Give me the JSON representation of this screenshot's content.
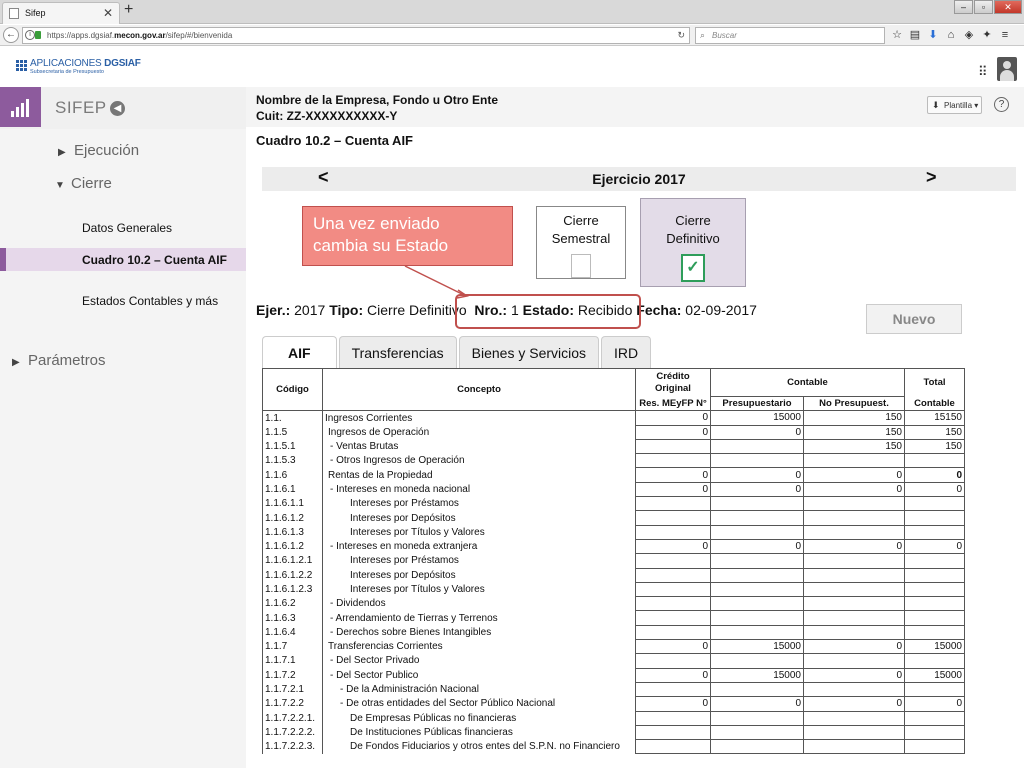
{
  "browser": {
    "tab_title": "Sifep",
    "url_prefix": "https://apps.dgsiaf.",
    "url_domain": "mecon.gov.ar",
    "url_suffix": "/sifep/#/bienvenida",
    "search_placeholder": "Buscar"
  },
  "app": {
    "logo_title": "APLICACIONES",
    "logo_brand": "DGSIAF",
    "logo_subtitle": "Subsecretaria de Presupuesto"
  },
  "sidebar": {
    "title": "SIFEP",
    "items": [
      {
        "label": "Ejecución"
      },
      {
        "label": "Cierre"
      },
      {
        "label": "Datos Generales"
      },
      {
        "label": "Cuadro 10.2  – Cuenta AIF"
      },
      {
        "label": "Estados Contables y más"
      },
      {
        "label": "Parámetros"
      }
    ]
  },
  "header": {
    "company_name": "Nombre de la Empresa, Fondo u Otro Ente",
    "cuit": "Cuit: ZZ-XXXXXXXXXX-Y",
    "plantilla_label": "Plantilla",
    "help": "?"
  },
  "page": {
    "title": "Cuadro 10.2  – Cuenta AIF",
    "prev": "<",
    "next": ">",
    "ejercicio": "Ejercicio 2017"
  },
  "callout": {
    "text_line1": "Una vez enviado",
    "text_line2": "cambia su Estado"
  },
  "cards": {
    "semestral_line1": "Cierre",
    "semestral_line2": "Semestral",
    "definitivo_line1": "Cierre",
    "definitivo_line2": "Definitivo"
  },
  "status": {
    "ejer_label": "Ejer.:",
    "ejer_value": "2017",
    "tipo_label": "Tipo:",
    "tipo_value": "Cierre Definitivo",
    "nro_label": "Nro.:",
    "nro_value": "1",
    "estado_label": "Estado:",
    "estado_value": "Recibido",
    "fecha_label": "Fecha:",
    "fecha_value": "02-09-2017"
  },
  "nuevo_label": "Nuevo",
  "tabs": [
    "AIF",
    "Transferencias",
    "Bienes y Servicios",
    "IRD"
  ],
  "table": {
    "h_codigo": "Código",
    "h_concepto": "Concepto",
    "h_credito_line1": "Crédito",
    "h_credito_line2": "Original",
    "h_credito_sub": "Res. MEyFP N°",
    "h_contable": "Contable",
    "h_presupuestario": "Presupuestario",
    "h_nopresupuest": "No Presupuest.",
    "h_total": "Total",
    "h_total_sub": "Contable",
    "rows": [
      {
        "code": "1.1.",
        "concept": "Ingresos Corrientes",
        "ind": 0,
        "c": "0",
        "p": "15000",
        "np": "150",
        "t": "15150"
      },
      {
        "code": "1.1.5",
        "concept": "Ingresos de Operación",
        "ind": 1,
        "c": "0",
        "p": "0",
        "np": "150",
        "t": "150"
      },
      {
        "code": "1.1.5.1",
        "concept": "- Ventas Brutas",
        "ind": 2,
        "c": "",
        "p": "",
        "np": "150",
        "t": "150"
      },
      {
        "code": "1.1.5.3",
        "concept": "- Otros Ingresos de Operación",
        "ind": 2,
        "c": "",
        "p": "",
        "np": "",
        "t": ""
      },
      {
        "code": "1.1.6",
        "concept": "Rentas de la Propiedad",
        "ind": 1,
        "c": "0",
        "p": "0",
        "np": "0",
        "t": "0"
      },
      {
        "code": "1.1.6.1",
        "concept": "- Intereses en moneda nacional",
        "ind": 2,
        "c": "0",
        "p": "0",
        "np": "0",
        "t": "0"
      },
      {
        "code": "1.1.6.1.1",
        "concept": "Intereses por Préstamos",
        "ind": 3,
        "c": "",
        "p": "",
        "np": "",
        "t": ""
      },
      {
        "code": "1.1.6.1.2",
        "concept": "Intereses por Depósitos",
        "ind": 3,
        "c": "",
        "p": "",
        "np": "",
        "t": ""
      },
      {
        "code": "1.1.6.1.3",
        "concept": "Intereses por Títulos y Valores",
        "ind": 3,
        "c": "",
        "p": "",
        "np": "",
        "t": ""
      },
      {
        "code": "1.1.6.1.2",
        "concept": "- Intereses en moneda extranjera",
        "ind": 2,
        "c": "0",
        "p": "0",
        "np": "0",
        "t": "0"
      },
      {
        "code": "1.1.6.1.2.1",
        "concept": "Intereses por Préstamos",
        "ind": 3,
        "c": "",
        "p": "",
        "np": "",
        "t": ""
      },
      {
        "code": "1.1.6.1.2.2",
        "concept": "Intereses por Depósitos",
        "ind": 3,
        "c": "",
        "p": "",
        "np": "",
        "t": ""
      },
      {
        "code": "1.1.6.1.2.3",
        "concept": "Intereses por Títulos y Valores",
        "ind": 3,
        "c": "",
        "p": "",
        "np": "",
        "t": ""
      },
      {
        "code": "1.1.6.2",
        "concept": "- Dividendos",
        "ind": 2,
        "c": "",
        "p": "",
        "np": "",
        "t": ""
      },
      {
        "code": "1.1.6.3",
        "concept": "- Arrendamiento de Tierras y Terrenos",
        "ind": 2,
        "c": "",
        "p": "",
        "np": "",
        "t": ""
      },
      {
        "code": "1.1.6.4",
        "concept": "- Derechos sobre Bienes Intangibles",
        "ind": 2,
        "c": "",
        "p": "",
        "np": "",
        "t": ""
      },
      {
        "code": "1.1.7",
        "concept": "Transferencias Corrientes",
        "ind": 1,
        "c": "0",
        "p": "15000",
        "np": "0",
        "t": "15000"
      },
      {
        "code": "1.1.7.1",
        "concept": "- Del Sector Privado",
        "ind": 2,
        "c": "",
        "p": "",
        "np": "",
        "t": ""
      },
      {
        "code": "1.1.7.2",
        "concept": "- Del Sector Publico",
        "ind": 2,
        "c": "0",
        "p": "15000",
        "np": "0",
        "t": "15000"
      },
      {
        "code": "1.1.7.2.1",
        "concept": "- De la Administración Nacional",
        "ind": 4,
        "c": "",
        "p": "",
        "np": "",
        "t": ""
      },
      {
        "code": "1.1.7.2.2",
        "concept": "- De otras entidades del Sector Público Nacional",
        "ind": 4,
        "c": "0",
        "p": "0",
        "np": "0",
        "t": "0"
      },
      {
        "code": "1.1.7.2.2.1.",
        "concept": "De Empresas Públicas no financieras",
        "ind": 3,
        "c": "",
        "p": "",
        "np": "",
        "t": ""
      },
      {
        "code": "1.1.7.2.2.2.",
        "concept": "De Instituciones Públicas financieras",
        "ind": 3,
        "c": "",
        "p": "",
        "np": "",
        "t": ""
      },
      {
        "code": "1.1.7.2.2.3.",
        "concept": "De Fondos Fiduciarios y otros entes del S.P.N. no Financiero",
        "ind": 3,
        "c": "",
        "p": "",
        "np": "",
        "t": ""
      }
    ]
  }
}
